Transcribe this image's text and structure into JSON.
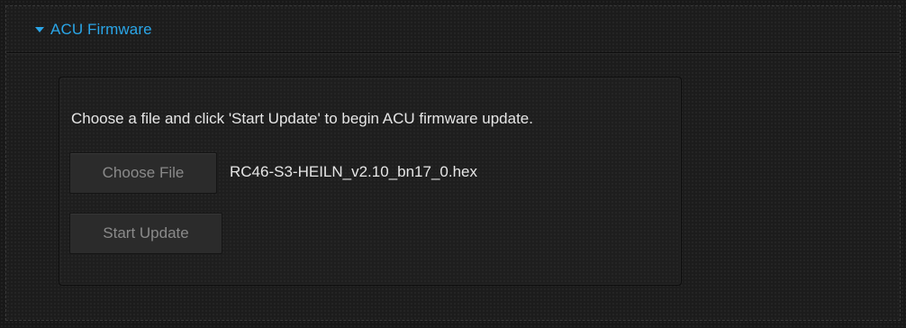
{
  "section": {
    "title": "ACU Firmware",
    "caret_icon": "caret-down-icon",
    "accent_color": "#2aa6e8"
  },
  "firmware": {
    "instructions": "Choose a file and click 'Start Update' to begin ACU firmware update.",
    "choose_file_label": "Choose File",
    "selected_file": "RC46-S3-HEILN_v2.10_bn17_0.hex",
    "start_update_label": "Start Update"
  }
}
